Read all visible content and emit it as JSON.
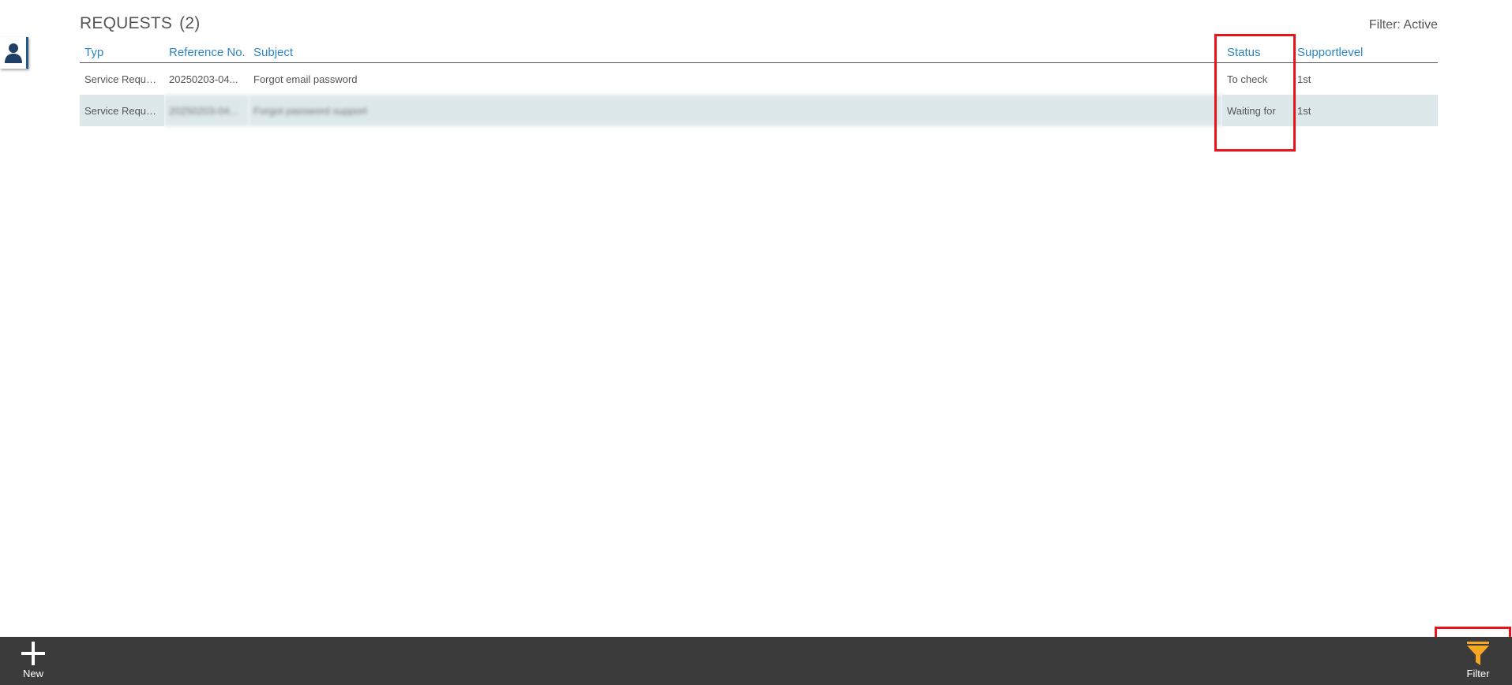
{
  "page": {
    "title": "REQUESTS",
    "count": "(2)",
    "filter_status": "Filter: Active"
  },
  "table": {
    "columns": [
      "Typ",
      "Reference No.",
      "Subject",
      "Status",
      "Supportlevel"
    ],
    "rows": [
      {
        "typ": "Service Reque...",
        "reference": "20250203-04...",
        "subject": "Forgot email password",
        "status": "To check",
        "supportlevel": "1st",
        "blurred": false
      },
      {
        "typ": "Service Reque...",
        "reference": "20250203-04...",
        "subject": "Forgot password support",
        "status": "Waiting for",
        "supportlevel": "1st",
        "blurred": true
      }
    ]
  },
  "toolbar": {
    "new_label": "New",
    "filter_label": "Filter"
  },
  "colors": {
    "accent": "#2e86c1",
    "bar": "#3b3b3b",
    "filter_icon": "#f5a623",
    "highlight": "#e8141b",
    "row_alt": "#dde8ea"
  },
  "icons": {
    "user": "user-icon",
    "new": "plus-icon",
    "filter": "funnel-icon"
  }
}
